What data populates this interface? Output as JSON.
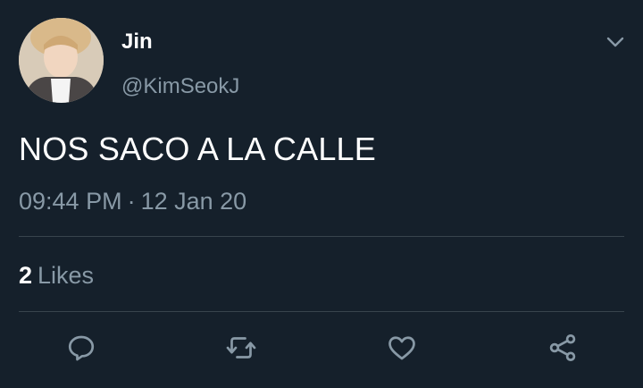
{
  "tweet": {
    "display_name": "Jin",
    "handle": "@KimSeokJ",
    "text": "NOS SACO A LA CALLE",
    "time": "09:44 PM",
    "separator": "·",
    "date": "12 Jan 20",
    "likes_count": "2",
    "likes_label": "Likes"
  },
  "icons": {
    "menu": "chevron-down-icon",
    "reply": "reply-icon",
    "retweet": "retweet-icon",
    "like": "heart-icon",
    "share": "share-icon"
  },
  "colors": {
    "background": "#15202b",
    "primary_text": "#ffffff",
    "secondary_text": "#8899a6",
    "divider": "#38444d"
  }
}
